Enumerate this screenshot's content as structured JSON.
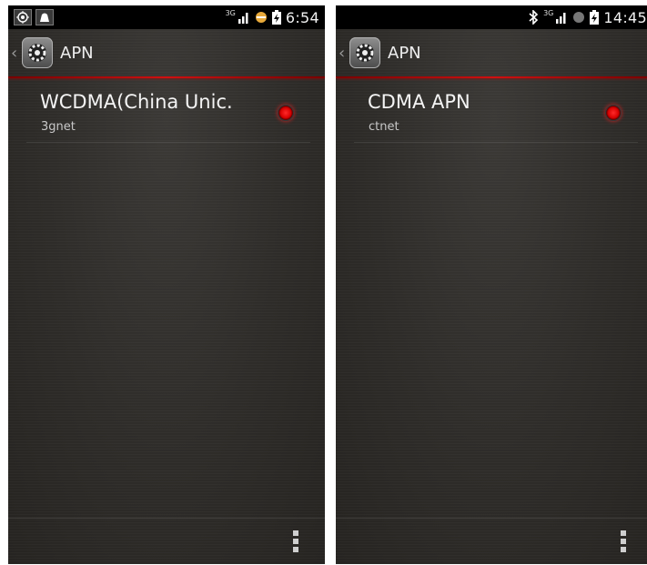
{
  "screens": [
    {
      "status_bar": {
        "notifications": [
          "location-icon",
          "bbm-icon"
        ],
        "network_type": "3G",
        "time": "6:54"
      },
      "action_bar": {
        "title": "APN"
      },
      "apn": {
        "name": "WCDMA(China Unic.",
        "sub": "3gnet",
        "selected": true
      }
    },
    {
      "status_bar": {
        "notifications": [],
        "network_type": "3G",
        "time": "14:45"
      },
      "action_bar": {
        "title": "APN"
      },
      "apn": {
        "name": "CDMA APN",
        "sub": "ctnet",
        "selected": true
      }
    }
  ],
  "colors": {
    "accent": "#d01010",
    "background": "#2e2c29",
    "status_bar": "#000000"
  }
}
